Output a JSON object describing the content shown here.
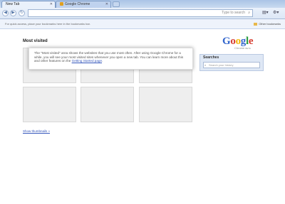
{
  "tabs": [
    {
      "label": "New Tab",
      "active": true
    },
    {
      "label": "Google Chrome",
      "active": false
    }
  ],
  "toolbar": {
    "back_icon": "back-arrow-icon",
    "forward_icon": "forward-arrow-icon",
    "reload_icon": "reload-icon",
    "omnibox_placeholder": "Type to search",
    "page_menu_icon": "page-menu-icon",
    "wrench_menu_icon": "wrench-icon"
  },
  "bookmarks_bar": {
    "hint": "For quick access, place your bookmarks here in the bookmarks bar.",
    "other_bookmarks": "Other bookmarks"
  },
  "main": {
    "most_visited_title": "Most visited",
    "info_text": "The \"Most visited\" area shows the websites that you use most often. After using Google Chrome for a while, you will see your most visited sites whenever you open a new tab. You can learn more about this and other features on the",
    "info_link": "Getting Started page",
    "info_end": ".",
    "show_thumbnails": "Show thumbnails »"
  },
  "logo": {
    "word": [
      "G",
      "o",
      "o",
      "g",
      "l",
      "e"
    ],
    "colors": [
      "#3366cc",
      "#d63b2f",
      "#f4b400",
      "#3366cc",
      "#2a9d3f",
      "#d63b2f"
    ],
    "sub": "Chrome",
    "beta": "BETA"
  },
  "sidebar": {
    "searches_title": "Searches",
    "search_placeholder": "Search your history"
  }
}
